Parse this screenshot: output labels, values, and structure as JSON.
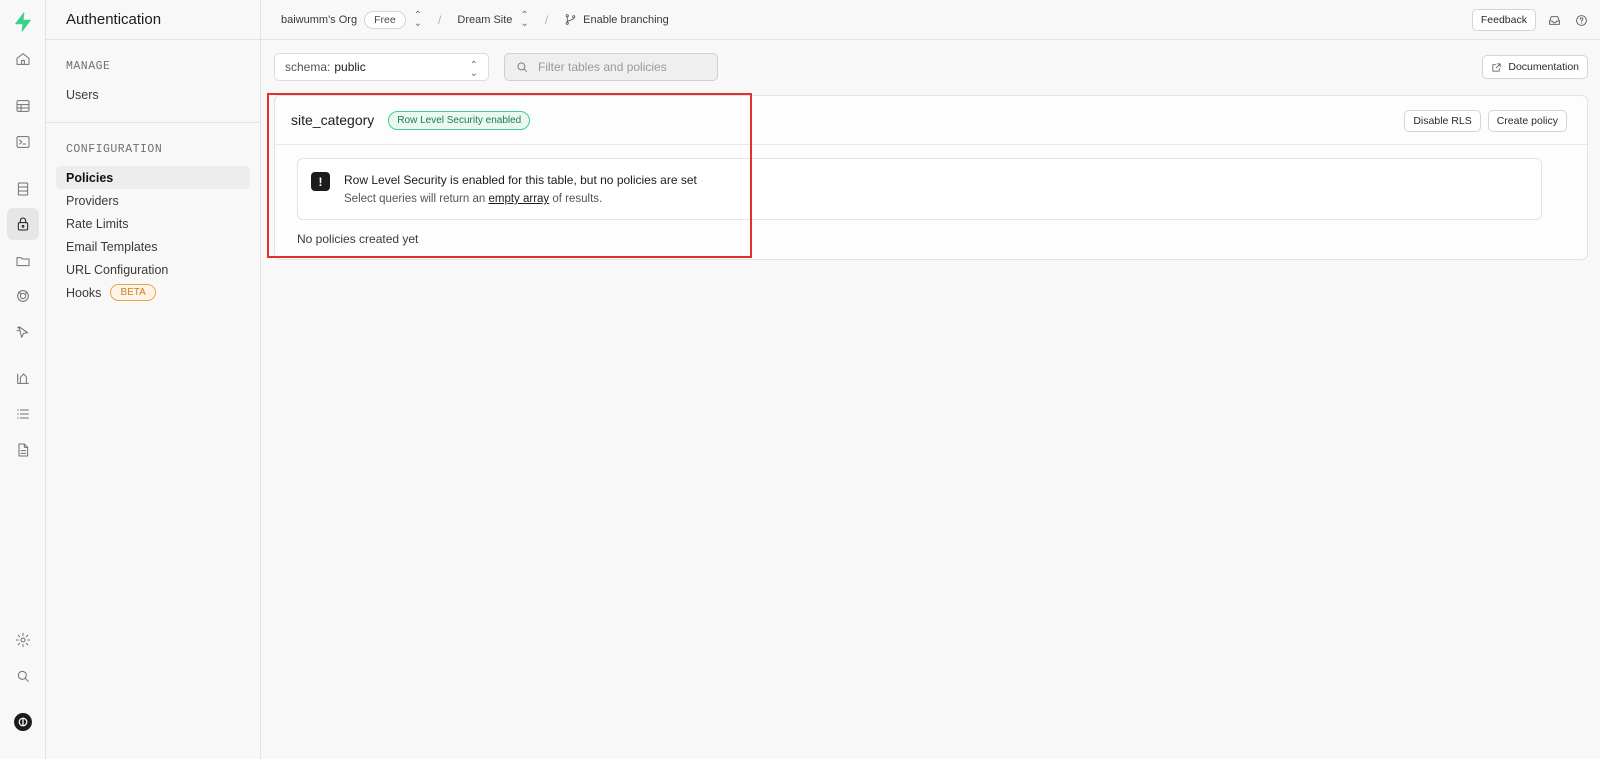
{
  "rail": {
    "icons": [
      "supabase-logo-icon",
      "home-icon",
      "table-editor-icon",
      "sql-editor-icon",
      "database-icon",
      "authentication-icon",
      "storage-icon",
      "realtime-icon",
      "edge-functions-icon",
      "reports-icon",
      "logs-icon",
      "api-docs-icon",
      "settings-icon",
      "search-icon",
      "user-avatar-icon"
    ],
    "active": "authentication-icon",
    "accent": "#3ecf8e"
  },
  "sidebar": {
    "title": "Authentication",
    "manage": {
      "heading": "MANAGE",
      "items": [
        "Users"
      ]
    },
    "configuration": {
      "heading": "CONFIGURATION",
      "items": [
        "Policies",
        "Providers",
        "Rate Limits",
        "Email Templates",
        "URL Configuration",
        "Hooks"
      ],
      "active": "Policies",
      "hooks_badge": "BETA"
    }
  },
  "topbar": {
    "org": "baiwumm's Org",
    "plan": "Free",
    "separator": "/",
    "project": "Dream Site",
    "branch": "Enable branching",
    "feedback": "Feedback"
  },
  "main": {
    "schema_label": "schema:",
    "schema_value": "public",
    "filter_placeholder": "Filter tables and policies",
    "documentation": "Documentation",
    "table": {
      "name": "site_category",
      "rls_badge": "Row Level Security enabled",
      "disable_rls": "Disable RLS",
      "create_policy": "Create policy",
      "alert_icon": "!",
      "alert_title": "Row Level Security is enabled for this table, but no policies are set",
      "alert_desc_before": "Select queries will return an",
      "alert_desc_link": "empty array",
      "alert_desc_after": "of results.",
      "empty_text": "No policies created yet"
    }
  },
  "colors": {
    "highlight_border": "#e03131",
    "badge_green": "#3ecf8e",
    "beta_orange": "#e8a64a"
  }
}
